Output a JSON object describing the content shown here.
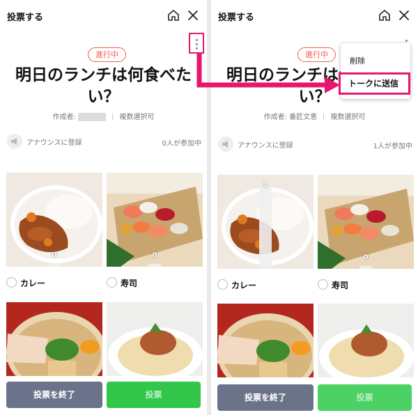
{
  "colors": {
    "accent_pink": "#e8166f",
    "status_red": "#f45a4a",
    "end_button": "#6a7389",
    "vote_button": "#32c64a"
  },
  "left": {
    "header_title": "投票する",
    "status": "進行中",
    "question": "明日のランチは何食べたい？",
    "meta_author_label": "作成者:",
    "meta_mode": "複数選択可",
    "announce_label": "アナウンスに登録",
    "participants": "0人が参加中",
    "options": [
      {
        "name": "カレー",
        "count": "0",
        "image": "curry-rice-photo",
        "vote_share": 0.03
      },
      {
        "name": "寿司",
        "count": "0",
        "image": "sushi-platter-photo",
        "vote_share": 0.03
      },
      {
        "name": "",
        "count": "",
        "image": "ramen-photo"
      },
      {
        "name": "",
        "count": "",
        "image": "pasta-photo"
      }
    ],
    "end_button": "投票を終了",
    "vote_button": "投票"
  },
  "right": {
    "header_title": "投票する",
    "status": "進行中",
    "question": "明日のランチは何食べたい？",
    "meta_author_label": "作成者: 番匠文恵",
    "meta_mode": "複数選択可",
    "announce_label": "アナウンスに登録",
    "participants": "1人が参加中",
    "options": [
      {
        "name": "カレー",
        "count": "1",
        "image": "curry-rice-photo",
        "vote_share": 1.0
      },
      {
        "name": "寿司",
        "count": "0",
        "image": "sushi-platter-photo",
        "vote_share": 0.03
      },
      {
        "name": "",
        "count": "",
        "image": "ramen-photo"
      },
      {
        "name": "",
        "count": "",
        "image": "pasta-photo"
      }
    ],
    "end_button": "投票を終了",
    "vote_button": "投票",
    "menu": {
      "delete": "削除",
      "send_to_talk": "トークに送信"
    }
  }
}
